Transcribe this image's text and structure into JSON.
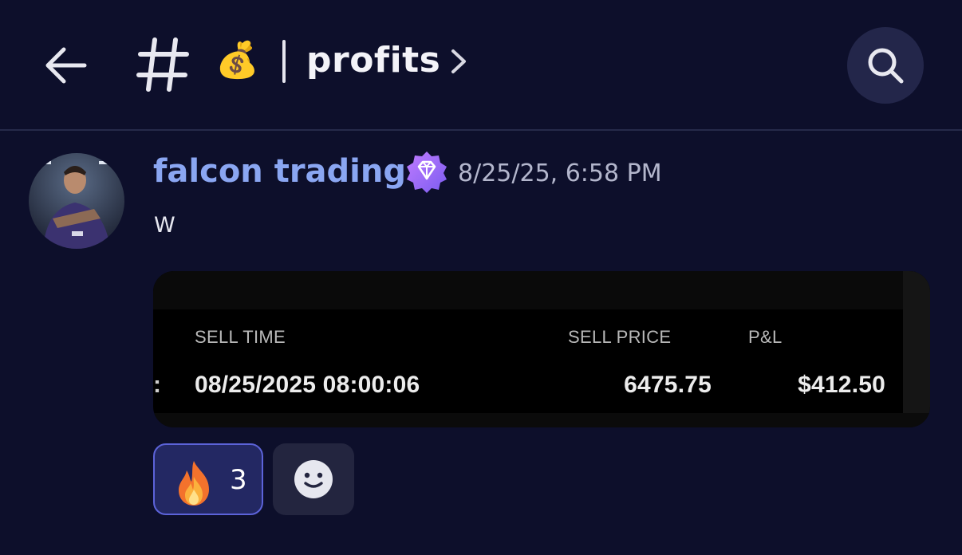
{
  "header": {
    "back_icon": "arrow-left-icon",
    "hash_icon": "hash-icon",
    "channel_emoji": "💰",
    "channel_name": "profits",
    "chevron_icon": "chevron-right-icon",
    "search_icon": "search-icon"
  },
  "message": {
    "author": "falcon trading",
    "badge_icon": "gem-badge-icon",
    "timestamp": "8/25/25, 6:58 PM",
    "text": "W",
    "author_color": "#8aa6f2"
  },
  "embed": {
    "columns": [
      "SELL TIME",
      "SELL PRICE",
      "P&L"
    ],
    "edge_char": ":",
    "row": {
      "sell_time": "08/25/2025 08:00:06",
      "sell_price": "6475.75",
      "pnl": "$412.50"
    }
  },
  "reactions": [
    {
      "emoji": "fire-icon",
      "count": "3",
      "active": true
    }
  ],
  "add_reaction_icon": "smiley-icon",
  "colors": {
    "background": "#0d0f2b",
    "reaction_border": "#5c63d9",
    "reaction_bg": "#232863"
  }
}
